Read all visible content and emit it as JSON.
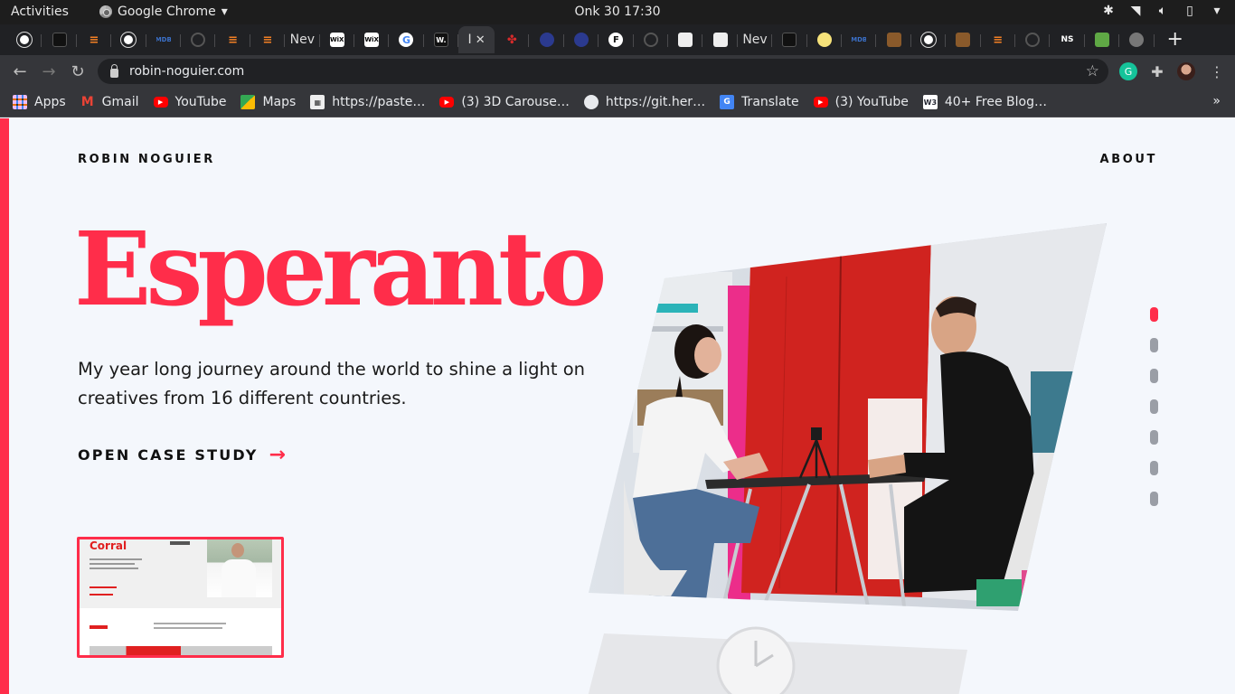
{
  "system_bar": {
    "activities": "Activities",
    "app_name": "Google Chrome",
    "clock": "Onk 30  17:30"
  },
  "browser": {
    "tabs": [
      {
        "icon": "globe-icon",
        "label": ""
      },
      {
        "icon": "stackbit-icon",
        "label": ""
      },
      {
        "icon": "stackoverflow-icon",
        "label": ""
      },
      {
        "icon": "globe-icon",
        "label": ""
      },
      {
        "icon": "mdb-icon",
        "label": "MDB"
      },
      {
        "icon": "circle-icon",
        "label": ""
      },
      {
        "icon": "stackoverflow-icon",
        "label": ""
      },
      {
        "icon": "stackoverflow-icon",
        "label": ""
      },
      {
        "icon": "text-tab",
        "label": "Nev"
      },
      {
        "icon": "wix-icon",
        "label": "WiX"
      },
      {
        "icon": "wix-icon",
        "label": "WiX"
      },
      {
        "icon": "google-icon",
        "label": "G"
      },
      {
        "icon": "webflow-icon",
        "label": "W."
      },
      {
        "icon": "active-tab",
        "label": "I"
      },
      {
        "icon": "red-leaf-icon",
        "label": ""
      },
      {
        "icon": "navy-dot-icon",
        "label": ""
      },
      {
        "icon": "navy-dot-icon",
        "label": ""
      },
      {
        "icon": "f-icon",
        "label": "F"
      },
      {
        "icon": "circle-icon",
        "label": ""
      },
      {
        "icon": "grid-icon",
        "label": ""
      },
      {
        "icon": "puzzle-tab-icon",
        "label": ""
      },
      {
        "icon": "text-tab",
        "label": "Nev"
      },
      {
        "icon": "stackbit-icon",
        "label": ""
      },
      {
        "icon": "yellow-dot-icon",
        "label": ""
      },
      {
        "icon": "mdb-icon",
        "label": "MDB"
      },
      {
        "icon": "book-icon",
        "label": ""
      },
      {
        "icon": "globe-icon",
        "label": ""
      },
      {
        "icon": "book-icon",
        "label": ""
      },
      {
        "icon": "stackoverflow-icon",
        "label": ""
      },
      {
        "icon": "shield-icon",
        "label": ""
      },
      {
        "icon": "ns-icon",
        "label": "NS"
      },
      {
        "icon": "wg-icon",
        "label": ""
      },
      {
        "icon": "gray-globe-icon",
        "label": ""
      }
    ],
    "url": "robin-noguier.com",
    "bookmarks": [
      {
        "icon": "apps-icon",
        "label": "Apps"
      },
      {
        "icon": "gmail-icon",
        "label": "Gmail"
      },
      {
        "icon": "youtube-icon",
        "label": "YouTube"
      },
      {
        "icon": "maps-icon",
        "label": "Maps"
      },
      {
        "icon": "pastebin-icon",
        "label": "https://paste…"
      },
      {
        "icon": "youtube-icon",
        "label": "(3) 3D Carouse…"
      },
      {
        "icon": "globe-icon",
        "label": "https://git.her…"
      },
      {
        "icon": "translate-icon",
        "label": "Translate"
      },
      {
        "icon": "youtube-icon",
        "label": "(3) YouTube"
      },
      {
        "icon": "w3-icon",
        "label": "40+ Free Blog…"
      }
    ],
    "bookmarks_more": "»"
  },
  "page": {
    "brand": "ROBIN NOGUIER",
    "nav_about": "ABOUT",
    "title": "Esperanto",
    "subtitle": "My year long journey around the world to shine a light on creatives from 16 different countries.",
    "cta": "OPEN CASE STUDY",
    "thumbnail_title": "Corral",
    "slides_total": 7,
    "slide_active": 1,
    "accent_color": "#ff2d4a"
  }
}
